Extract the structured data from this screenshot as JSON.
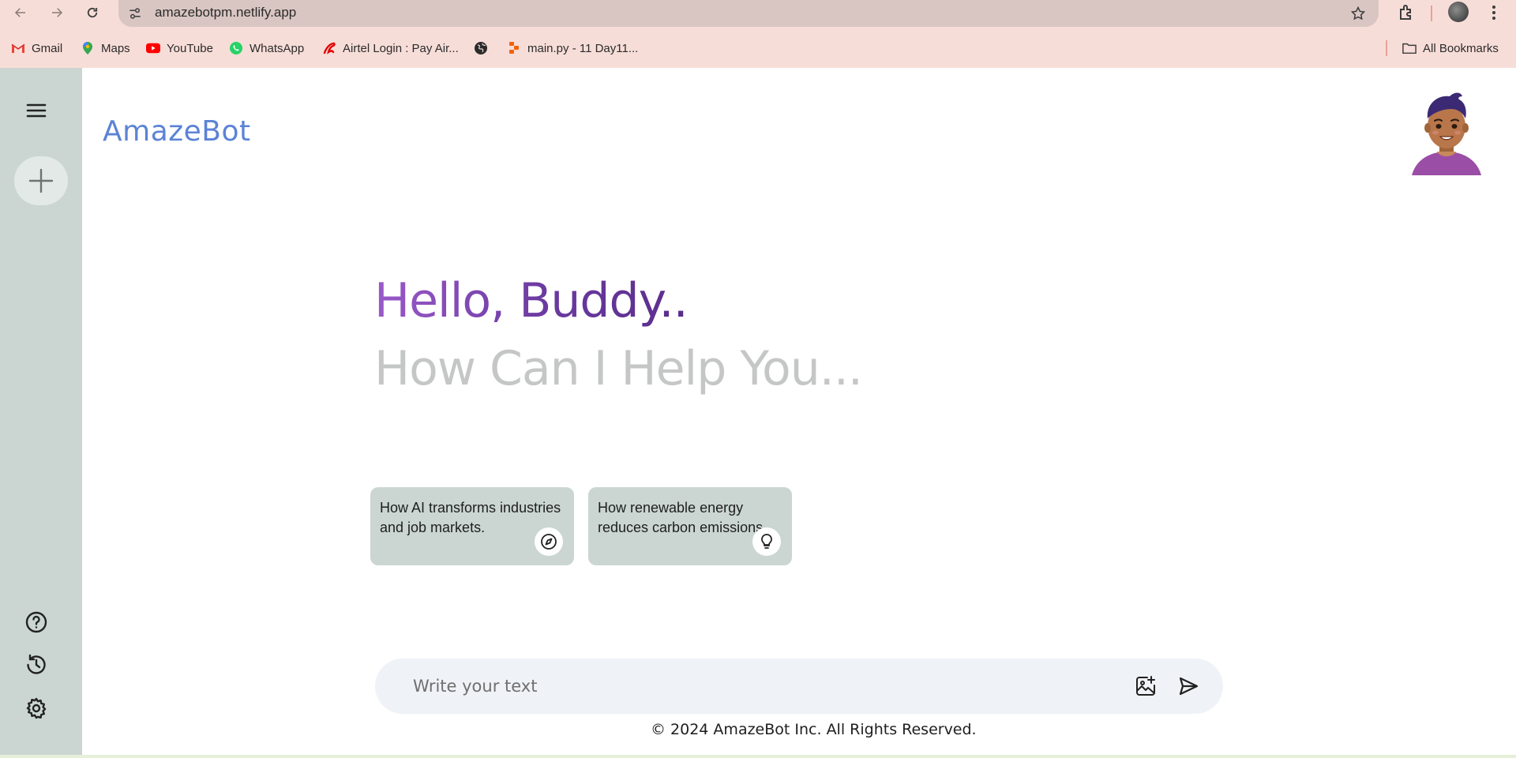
{
  "browser": {
    "url": "amazebotpm.netlify.app",
    "bookmarks": [
      {
        "label": "Gmail",
        "icon": "gmail-icon"
      },
      {
        "label": "Maps",
        "icon": "maps-icon"
      },
      {
        "label": "YouTube",
        "icon": "youtube-icon"
      },
      {
        "label": "WhatsApp",
        "icon": "whatsapp-icon"
      },
      {
        "label": "Airtel Login : Pay Air...",
        "icon": "airtel-icon"
      },
      {
        "label": "",
        "icon": "globe-icon"
      },
      {
        "label": "main.py - 11 Day11...",
        "icon": "replit-icon"
      }
    ],
    "all_bookmarks": "All Bookmarks"
  },
  "app": {
    "brand": "AmazeBot",
    "greeting": "Hello, Buddy..",
    "subgreeting": "How Can I Help You...",
    "cards": [
      {
        "text": "How AI transforms industries and job markets.",
        "icon": "compass-icon"
      },
      {
        "text": "How renewable energy reduces carbon emissions.",
        "icon": "bulb-icon"
      }
    ],
    "input_placeholder": "Write your text",
    "footer": "© 2024 AmazeBot Inc. All Rights Reserved."
  },
  "colors": {
    "chrome_bg": "#f7ddd8",
    "sidebar_bg": "#cbd6d2",
    "brand": "#5b83d6",
    "greeting_start": "#9b59c9",
    "greeting_end": "#5a2d8c",
    "subgreeting": "#c4c7c5",
    "composer_bg": "#eff2f6"
  }
}
